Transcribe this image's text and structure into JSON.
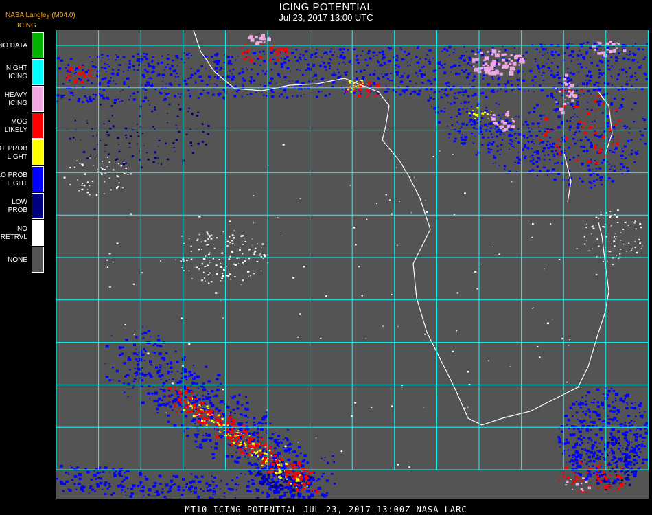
{
  "header": {
    "title": "ICING POTENTIAL",
    "subtitle": "Jul 23, 2017 13:00 UTC",
    "provider": "NASA Langley (M04.0)",
    "product": "ICING"
  },
  "legend": [
    {
      "label": [
        "NO DATA"
      ],
      "color": "#00b400"
    },
    {
      "label": [
        "NIGHT",
        "ICING"
      ],
      "color": "#00ffff"
    },
    {
      "label": [
        "HEAVY",
        "ICING"
      ],
      "color": "#f0a8e0"
    },
    {
      "label": [
        "MOG",
        "LIKELY"
      ],
      "color": "#ff0000"
    },
    {
      "label": [
        "HI PROB",
        "LIGHT"
      ],
      "color": "#ffff00"
    },
    {
      "label": [
        "LO PROB",
        "LIGHT"
      ],
      "color": "#0000ff"
    },
    {
      "label": [
        "LOW",
        "PROB"
      ],
      "color": "#000080"
    },
    {
      "label": [
        "NO",
        "RETRVL"
      ],
      "color": "#ffffff"
    },
    {
      "label": [
        "NONE"
      ],
      "color": "#545454"
    }
  ],
  "colors": {
    "background": "#000000",
    "map_fill": "#545454",
    "grid": "#00ffff",
    "coast": "#ffffff",
    "grid_label": "#ff3030",
    "header_accent": "#f5a623"
  },
  "footer": "MT10  ICING POTENTIAL   JUL 23, 2017 13:00Z   NASA LARC"
}
